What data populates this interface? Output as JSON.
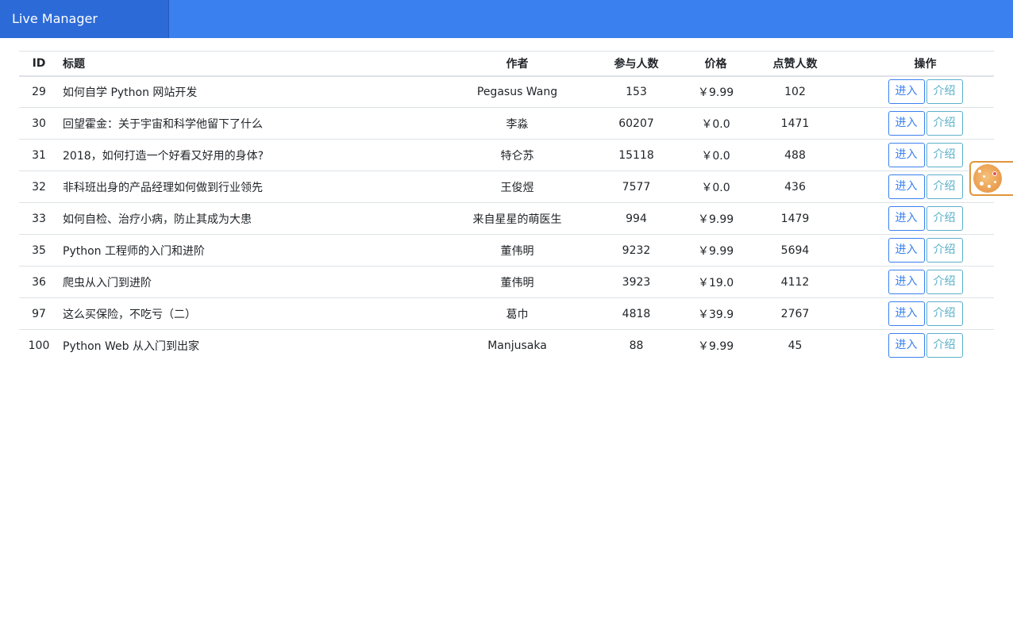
{
  "navbar": {
    "brand": "Live Manager",
    "color": "#3a80ef"
  },
  "table": {
    "headers": {
      "id": "ID",
      "title": "标题",
      "author": "作者",
      "participants": "参与人数",
      "price": "价格",
      "likes": "点赞人数",
      "actions": "操作"
    },
    "enter_label": "进入",
    "intro_label": "介绍",
    "rows": [
      {
        "id": "29",
        "title": "如何自学 Python 网站开发",
        "author": "Pegasus Wang",
        "participants": "153",
        "price": "￥9.99",
        "likes": "102"
      },
      {
        "id": "30",
        "title": "回望霍金：关于宇宙和科学他留下了什么",
        "author": "李淼",
        "participants": "60207",
        "price": "￥0.0",
        "likes": "1471"
      },
      {
        "id": "31",
        "title": "2018，如何打造一个好看又好用的身体?",
        "author": "特仑苏",
        "participants": "15118",
        "price": "￥0.0",
        "likes": "488"
      },
      {
        "id": "32",
        "title": "非科班出身的产品经理如何做到行业领先",
        "author": "王俊煜",
        "participants": "7577",
        "price": "￥0.0",
        "likes": "436"
      },
      {
        "id": "33",
        "title": "如何自检、治疗小病，防止其成为大患",
        "author": "来自星星的萌医生",
        "participants": "994",
        "price": "￥9.99",
        "likes": "1479"
      },
      {
        "id": "35",
        "title": "Python 工程师的入门和进阶",
        "author": "董伟明",
        "participants": "9232",
        "price": "￥9.99",
        "likes": "5694"
      },
      {
        "id": "36",
        "title": "爬虫从入门到进阶",
        "author": "董伟明",
        "participants": "3923",
        "price": "￥19.0",
        "likes": "4112"
      },
      {
        "id": "97",
        "title": "这么买保险，不吃亏（二）",
        "author": "葛巾",
        "participants": "4818",
        "price": "￥39.9",
        "likes": "2767"
      },
      {
        "id": "100",
        "title": "Python Web 从入门到出家",
        "author": "Manjusaka",
        "participants": "88",
        "price": "￥9.99",
        "likes": "45"
      }
    ]
  },
  "float_widget": {
    "icon": "cookie-avatar-icon",
    "accent": "#e0953a"
  }
}
